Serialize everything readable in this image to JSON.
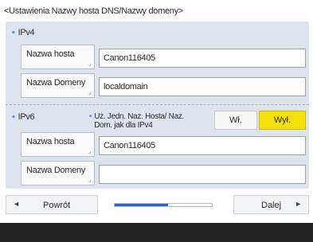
{
  "title": "<Ustawienia Nazwy hosta DNS/Nazwy domeny>",
  "ipv4": {
    "label": "IPv4",
    "host_label": "Nazwa hosta",
    "host_value": "Canon116405",
    "domain_label": "Nazwa Domeny",
    "domain_value": "localdomain"
  },
  "ipv6": {
    "label": "IPv6",
    "same_as_ipv4_label": "Uż. Jedn. Naz. Hosta/ Naz. Dom. jak dla IPv4",
    "toggle_on": "Wł.",
    "toggle_off": "Wył.",
    "selected": "Wył.",
    "host_label": "Nazwa hosta",
    "host_value": "Canon116405",
    "domain_label": "Nazwa Domeny",
    "domain_value": ""
  },
  "nav": {
    "back_label": "Powrót",
    "next_label": "Dalej",
    "progress": 0.55
  },
  "colors": {
    "accent_blue": "#2f62d8",
    "selected_yellow": "#f4e10c",
    "panel": "#dfe3ee"
  },
  "icons": {
    "back": "left-triangle-icon",
    "next": "right-triangle-icon",
    "bullet": "bullet-dot-icon"
  }
}
